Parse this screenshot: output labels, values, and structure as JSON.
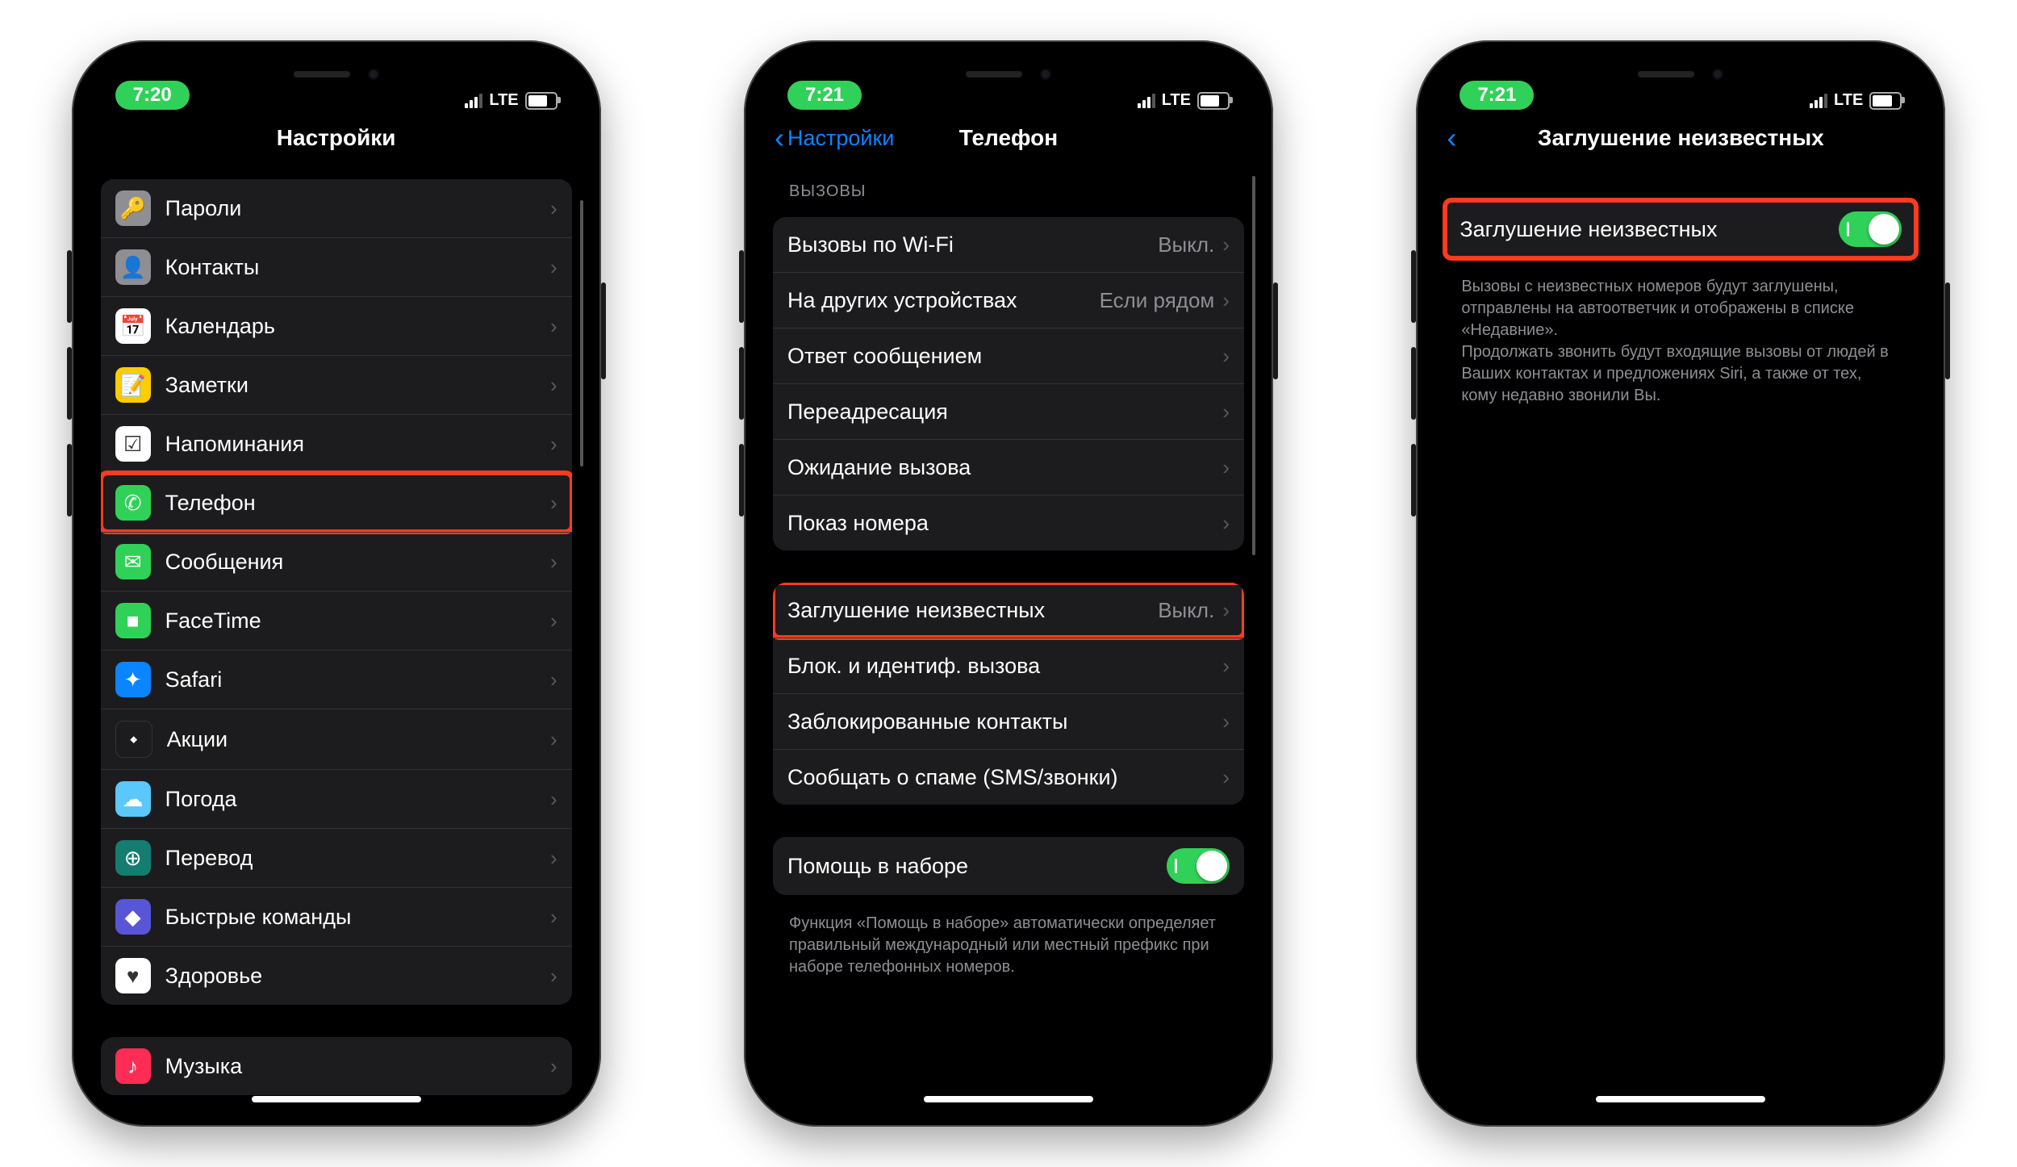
{
  "phone1": {
    "time": "7:20",
    "net": "LTE",
    "title": "Настройки",
    "items": [
      {
        "label": "Пароли",
        "icon": "🔑",
        "cls": "c-gray"
      },
      {
        "label": "Контакты",
        "icon": "👤",
        "cls": "c-gray"
      },
      {
        "label": "Календарь",
        "icon": "📅",
        "cls": "c-white"
      },
      {
        "label": "Заметки",
        "icon": "📝",
        "cls": "c-yellow"
      },
      {
        "label": "Напоминания",
        "icon": "☑︎",
        "cls": "c-white"
      },
      {
        "label": "Телефон",
        "icon": "✆",
        "cls": "c-green",
        "hi": true
      },
      {
        "label": "Сообщения",
        "icon": "✉︎",
        "cls": "c-green"
      },
      {
        "label": "FaceTime",
        "icon": "■",
        "cls": "c-green"
      },
      {
        "label": "Safari",
        "icon": "✦",
        "cls": "c-blue"
      },
      {
        "label": "Акции",
        "icon": "⬩",
        "cls": "c-dark"
      },
      {
        "label": "Погода",
        "icon": "☁︎",
        "cls": "c-sky"
      },
      {
        "label": "Перевод",
        "icon": "⊕",
        "cls": "c-teal"
      },
      {
        "label": "Быстрые команды",
        "icon": "◆",
        "cls": "c-purple"
      },
      {
        "label": "Здоровье",
        "icon": "♥︎",
        "cls": "c-white"
      }
    ],
    "extra": {
      "label": "Музыка",
      "icon": "♪",
      "cls": "c-red"
    }
  },
  "phone2": {
    "time": "7:21",
    "net": "LTE",
    "back": "Настройки",
    "title": "Телефон",
    "sec1": "ВЫЗОВЫ",
    "g1": [
      {
        "label": "Вызовы по Wi-Fi",
        "val": "Выкл."
      },
      {
        "label": "На других устройствах",
        "val": "Если рядом"
      },
      {
        "label": "Ответ сообщением"
      },
      {
        "label": "Переадресация"
      },
      {
        "label": "Ожидание вызова"
      },
      {
        "label": "Показ номера"
      }
    ],
    "g2": [
      {
        "label": "Заглушение неизвестных",
        "val": "Выкл.",
        "hi": true
      },
      {
        "label": "Блок. и идентиф. вызова"
      },
      {
        "label": "Заблокированные контакты"
      },
      {
        "label": "Сообщать о спаме (SMS/звонки)"
      }
    ],
    "dial": "Помощь в наборе",
    "foot": "Функция «Помощь в наборе» автоматически определяет правильный международный или местный префикс при наборе телефонных номеров."
  },
  "phone3": {
    "time": "7:21",
    "net": "LTE",
    "title": "Заглушение неизвестных",
    "row": "Заглушение неизвестных",
    "foot": "Вызовы с неизвестных номеров будут заглушены, отправлены на автоответчик и отображены в списке «Недавние».\nПродолжать звонить будут входящие вызовы от людей в Ваших контактах и предложениях Siri, а также от тех, кому недавно звонили Вы."
  }
}
